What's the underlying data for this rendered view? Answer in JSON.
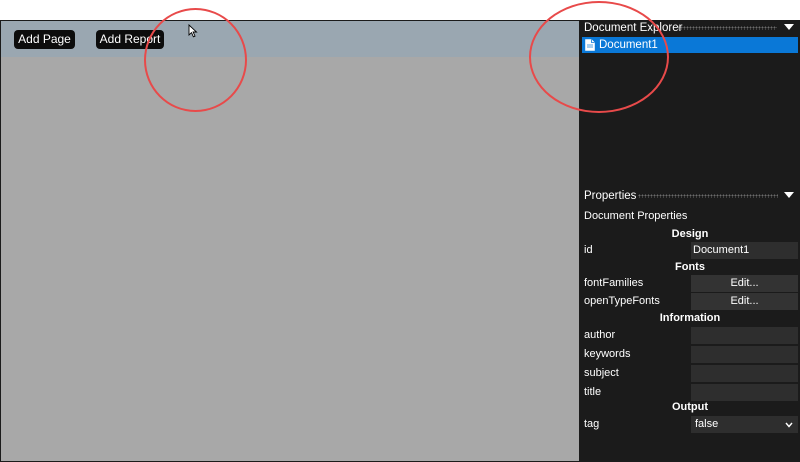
{
  "toolbar": {
    "add_page_label": "Add Page",
    "add_report_label": "Add Report"
  },
  "document_explorer": {
    "title": "Document Explorer",
    "items": [
      {
        "label": "Document1",
        "icon": "document-icon",
        "selected": true
      }
    ]
  },
  "properties": {
    "title": "Properties",
    "subtitle": "Document Properties",
    "sections": {
      "design": "Design",
      "fonts": "Fonts",
      "information": "Information",
      "output": "Output"
    },
    "fields": {
      "id": {
        "label": "id",
        "value": "Document1"
      },
      "fontFamilies": {
        "label": "fontFamilies",
        "button": "Edit..."
      },
      "openTypeFonts": {
        "label": "openTypeFonts",
        "button": "Edit..."
      },
      "author": {
        "label": "author",
        "value": ""
      },
      "keywords": {
        "label": "keywords",
        "value": ""
      },
      "subject": {
        "label": "subject",
        "value": ""
      },
      "title": {
        "label": "title",
        "value": ""
      },
      "tag": {
        "label": "tag",
        "value": "false"
      }
    }
  },
  "colors": {
    "selection": "#0a78d7",
    "annotation": "#e84a4a",
    "toolbar": "#9aa7b1",
    "canvas": "#a8a8a8"
  }
}
